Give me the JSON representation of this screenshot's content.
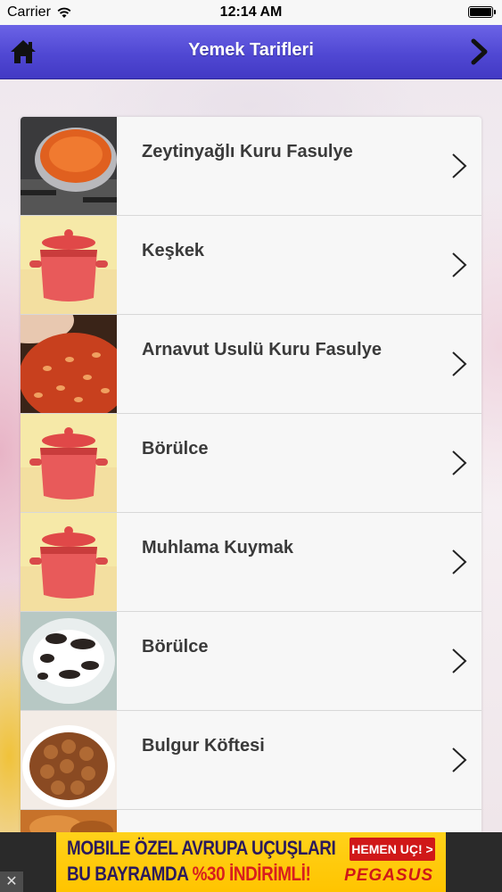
{
  "status_bar": {
    "carrier": "Carrier",
    "time": "12:14 AM",
    "icons": [
      "wifi-icon",
      "battery-icon"
    ]
  },
  "nav": {
    "title": "Yemek Tarifleri",
    "left_icon": "home-icon",
    "right_icon": "chevron-right-icon",
    "colors": {
      "bar_top": "#6b63e6",
      "bar_bottom": "#4239c4"
    }
  },
  "recipes": [
    {
      "label": "Zeytinyağlı Kuru Fasulye",
      "thumb": "pot-stove-photo"
    },
    {
      "label": "Keşkek",
      "thumb": "red-pot-placeholder"
    },
    {
      "label": "Arnavut Usulü Kuru Fasulye",
      "thumb": "beans-photo"
    },
    {
      "label": "Börülce",
      "thumb": "red-pot-placeholder"
    },
    {
      "label": "Muhlama Kuymak",
      "thumb": "red-pot-placeholder"
    },
    {
      "label": "Börülce",
      "thumb": "rice-plate-photo"
    },
    {
      "label": "Bulgur Köftesi",
      "thumb": "kofte-bowl-photo"
    },
    {
      "label": "",
      "thumb": "partial-photo"
    }
  ],
  "ad": {
    "line1": "MOBILE ÖZEL AVRUPA UÇUŞLARI",
    "line2_prefix": "BU BAYRAMDA ",
    "line2_highlight": "%30 İNDİRİMLİ!",
    "cta": "HEMEN UÇ! >",
    "brand": "PEGASUS",
    "close": "✕"
  }
}
